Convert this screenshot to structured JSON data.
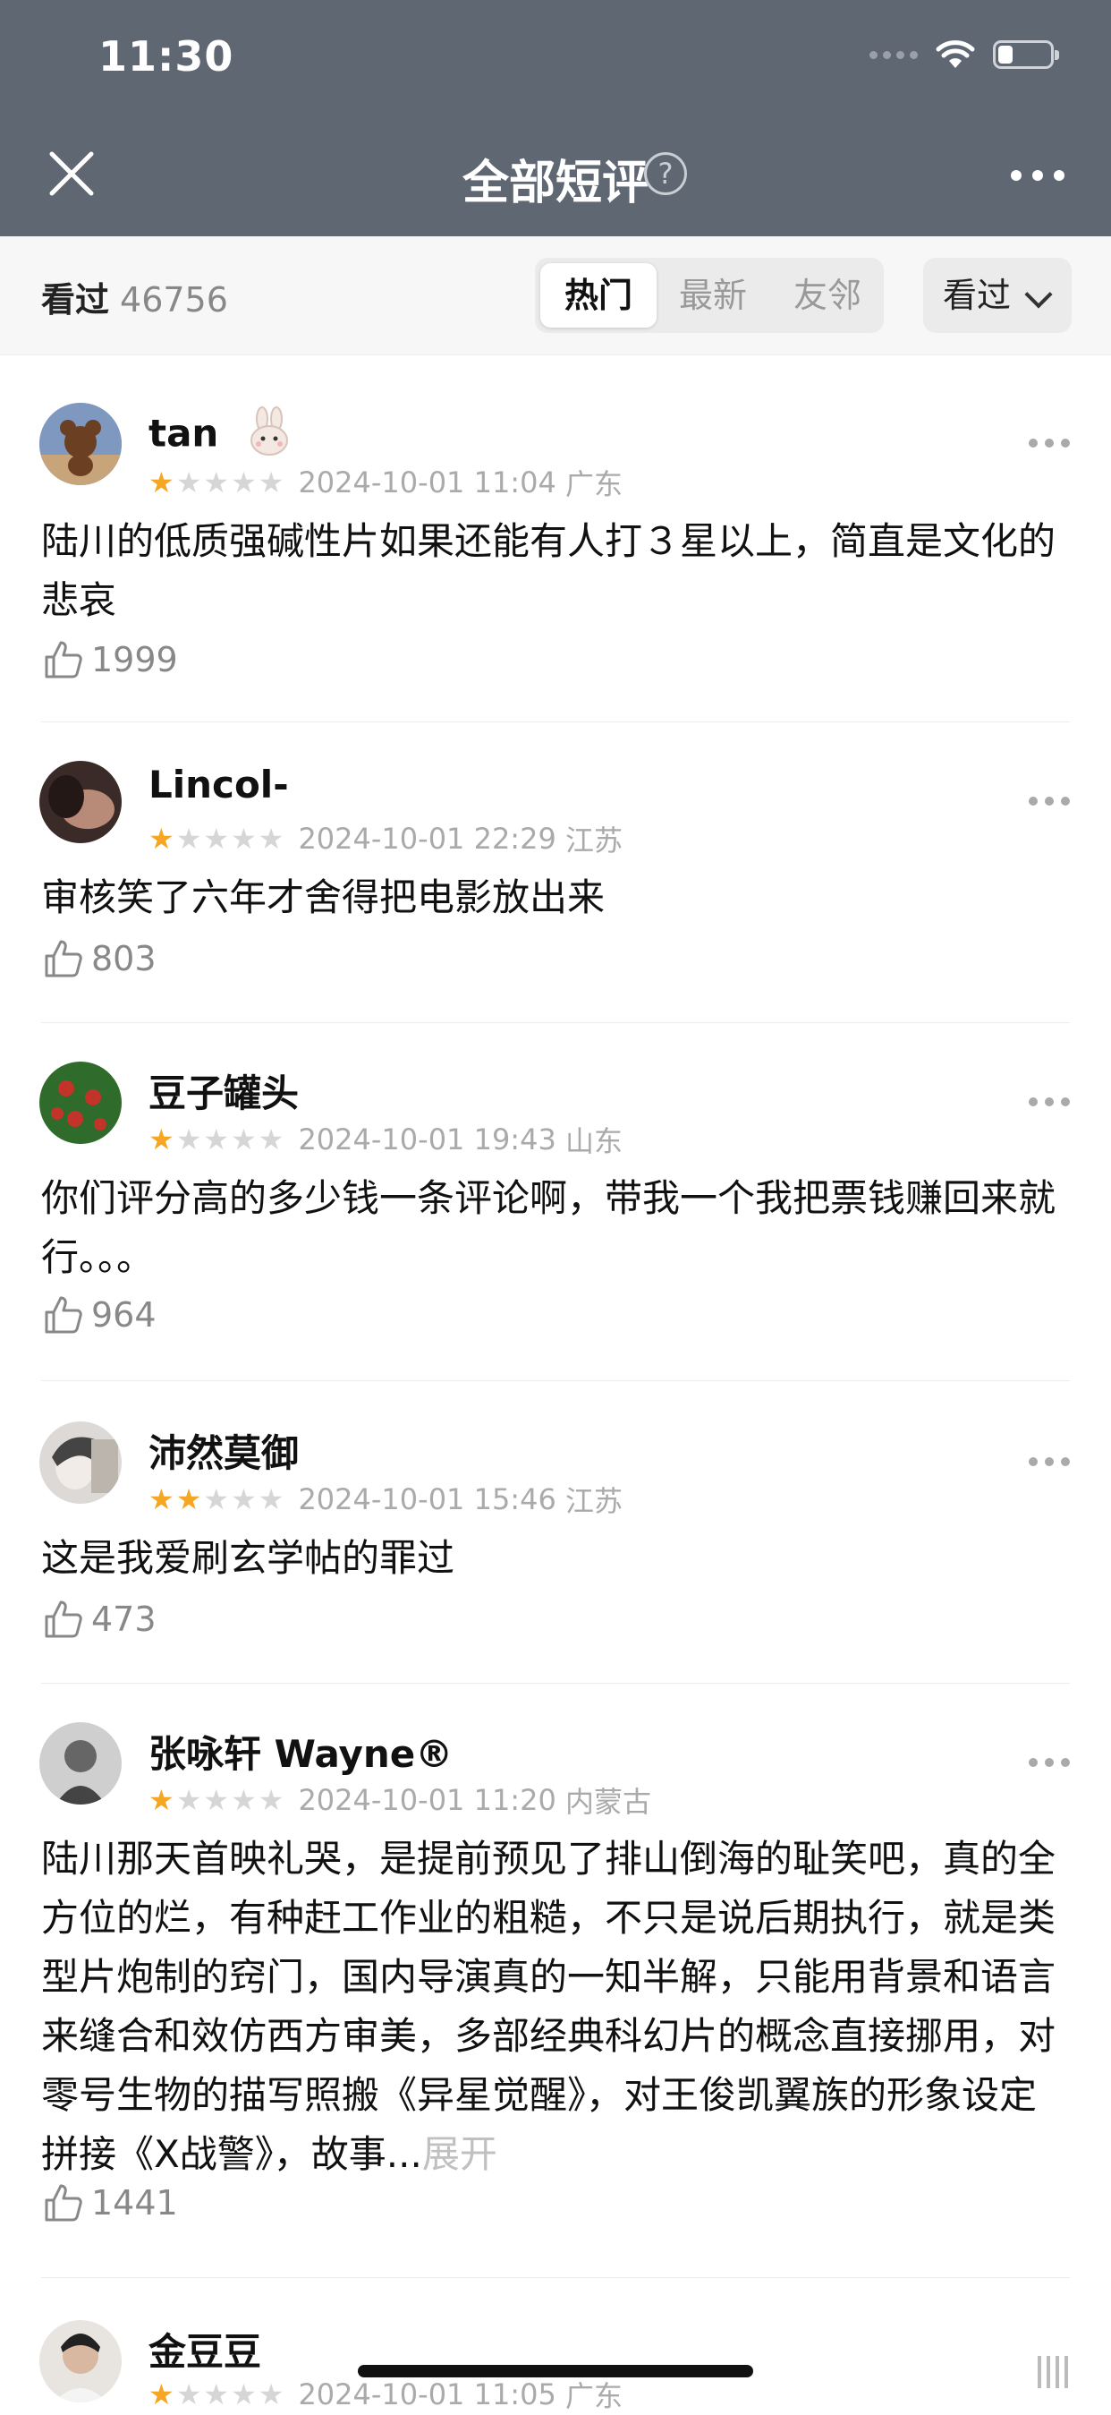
{
  "status_bar": {
    "time": "11:30"
  },
  "nav": {
    "title": "全部短评",
    "help_symbol": "?"
  },
  "filter": {
    "watched_label": "看过",
    "watched_count": "46756",
    "tabs": [
      {
        "label": "热门",
        "active": true
      },
      {
        "label": "最新",
        "active": false
      },
      {
        "label": "友邻",
        "active": false
      }
    ],
    "dropdown_label": "看过"
  },
  "colors": {
    "header_bg": "#5f6773",
    "star_active": "#f5a623",
    "star_inactive": "#d6d6d6"
  },
  "reviews": [
    {
      "name": "tan",
      "badge_icon": "rabbit-emoji-icon",
      "rating": 1,
      "date": "2024-10-01 11:04",
      "location": "广东",
      "text": "陆川的低质强碱性片如果还能有人打３星以上，简直是文化的悲哀",
      "likes": "1999",
      "expand": ""
    },
    {
      "name": "Lincol-",
      "rating": 1,
      "date": "2024-10-01 22:29",
      "location": "江苏",
      "text": "审核笑了六年才舍得把电影放出来",
      "likes": "803",
      "expand": ""
    },
    {
      "name": "豆子罐头",
      "rating": 1,
      "date": "2024-10-01 19:43",
      "location": "山东",
      "text": "你们评分高的多少钱一条评论啊，带我一个我把票钱赚回来就行。。。",
      "likes": "964",
      "expand": ""
    },
    {
      "name": "沛然莫御",
      "rating": 2,
      "date": "2024-10-01 15:46",
      "location": "江苏",
      "text": "这是我爱刷玄学帖的罪过",
      "likes": "473",
      "expand": ""
    },
    {
      "name": "张咏轩 Wayne®",
      "rating": 1,
      "date": "2024-10-01 11:20",
      "location": "内蒙古",
      "text": "陆川那天首映礼哭，是提前预见了排山倒海的耻笑吧，真的全方位的烂，有种赶工作业的粗糙，不只是说后期执行，就是类型片炮制的窍门，国内导演真的一知半解，只能用背景和语言来缝合和效仿西方审美，多部经典科幻片的概念直接挪用，对零号生物的描写照搬《异星觉醒》，对王俊凯翼族的形象设定拼接《X战警》，故事...",
      "likes": "1441",
      "expand": "展开"
    },
    {
      "name": "金豆豆",
      "rating": 1,
      "date": "2024-10-01 11:05",
      "location": "广东",
      "text": "",
      "likes": "",
      "expand": ""
    }
  ]
}
